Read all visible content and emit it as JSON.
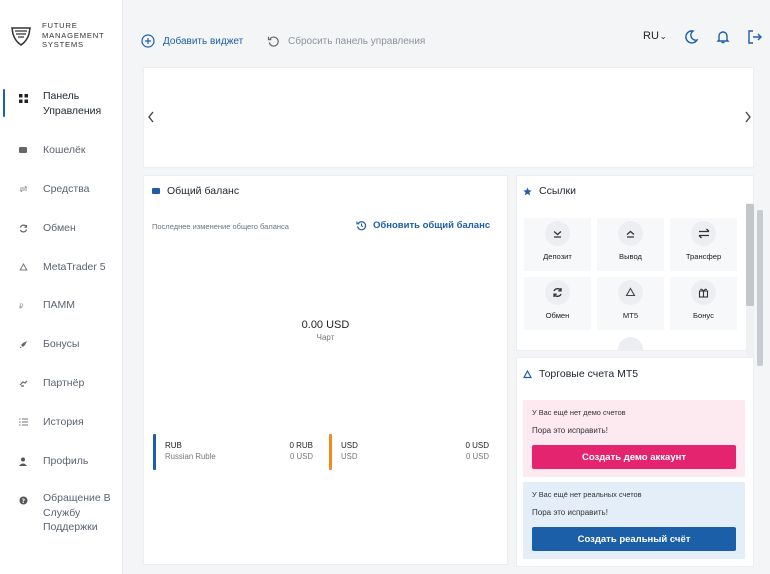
{
  "brand": {
    "lines": [
      "FUTURE",
      "MANAGEMENT",
      "SYSTEMS"
    ],
    "icon": "shield-logo-icon"
  },
  "sidebar": {
    "items": [
      {
        "label": "Панель Управления",
        "icon": "grid-icon",
        "active": true
      },
      {
        "label": "Кошелёк",
        "icon": "wallet-icon"
      },
      {
        "label": "Средства",
        "icon": "transfer-arrows-icon"
      },
      {
        "label": "Обмен",
        "icon": "exchange-icon"
      },
      {
        "label": "MetaTrader 5",
        "icon": "recycle-icon"
      },
      {
        "label": "ПАММ",
        "icon": "pamm-icon"
      },
      {
        "label": "Бонусы",
        "icon": "rocket-icon"
      },
      {
        "label": "Партнёр",
        "icon": "partner-icon"
      },
      {
        "label": "История",
        "icon": "list-icon"
      },
      {
        "label": "Профиль",
        "icon": "user-icon"
      },
      {
        "label": "Обращение В Службу Поддержки",
        "icon": "help-icon"
      }
    ]
  },
  "header": {
    "add_widget": "Добавить виджет",
    "reset_panel": "Сбросить панель управления",
    "language": "RU",
    "icons": [
      "moon-icon",
      "bell-icon",
      "logout-icon"
    ]
  },
  "balance": {
    "title": "Общий баланс",
    "last_change": "Последнее изменение общего баланса",
    "refresh": "Обновить общий баланс",
    "amount": "0.00 USD",
    "chart_label": "Чарт",
    "currencies": [
      {
        "code": "RUB",
        "name": "Russian Ruble",
        "amount": "0 RUB",
        "amount_usd": "0 USD",
        "color": "#1a5fa8"
      },
      {
        "code": "USD",
        "name": "USD",
        "amount": "0 USD",
        "amount_usd": "0 USD",
        "color": "#f08c1e"
      }
    ]
  },
  "links": {
    "title": "Ссылки",
    "tiles": [
      {
        "label": "Депозит",
        "icon": "deposit-icon"
      },
      {
        "label": "Вывод",
        "icon": "withdraw-icon"
      },
      {
        "label": "Трансфер",
        "icon": "transfer-icon"
      },
      {
        "label": "Обмен",
        "icon": "exchange-icon"
      },
      {
        "label": "MT5",
        "icon": "recycle-icon"
      },
      {
        "label": "Бонус",
        "icon": "gift-icon"
      }
    ]
  },
  "mt5": {
    "title": "Торговые счета MT5",
    "demo": {
      "note": "У Вас ещё нет демо счетов",
      "cta": "Пора это исправить!",
      "button": "Создать демо аккаунт",
      "bg": "#fdeaf1",
      "button_color": "#e5246f"
    },
    "real": {
      "note": "У Вас ещё нет реальных счетов",
      "cta": "Пора это исправить!",
      "button": "Создать реальный счёт",
      "bg": "#e3eef8",
      "button_color": "#1a5fa8"
    }
  },
  "colors": {
    "accent": "#1e5ea8",
    "muted": "#8c939c"
  }
}
